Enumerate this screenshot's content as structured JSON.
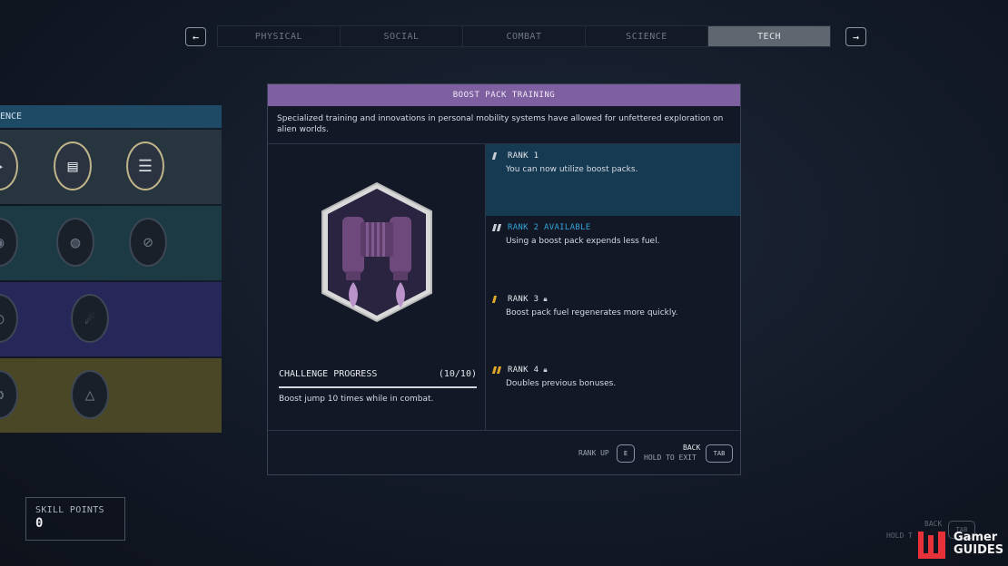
{
  "nav": {
    "prev_icon": "arrow-left-icon",
    "prev_glyph": "←",
    "next_icon": "arrow-right-icon",
    "next_glyph": "→",
    "tabs": [
      {
        "label": "PHYSICAL",
        "active": false
      },
      {
        "label": "SOCIAL",
        "active": false
      },
      {
        "label": "COMBAT",
        "active": false
      },
      {
        "label": "SCIENCE",
        "active": false
      },
      {
        "label": "TECH",
        "active": true
      }
    ]
  },
  "tree": {
    "header": "ENCE"
  },
  "modal": {
    "title": "BOOST PACK TRAINING",
    "description": "Specialized training and innovations in personal mobility systems have allowed for unfettered exploration on alien worlds.",
    "challenge": {
      "label": "CHALLENGE PROGRESS",
      "progress": "(10/10)",
      "description": "Boost jump 10 times while in combat."
    },
    "ranks": [
      {
        "label": "RANK 1",
        "text": "You can now utilize boost packs.",
        "state": "current"
      },
      {
        "label": "RANK 2 AVAILABLE",
        "text": "Using a boost pack expends less fuel.",
        "state": "available"
      },
      {
        "label": "RANK 3",
        "text": "Boost pack fuel regenerates more quickly.",
        "state": "locked"
      },
      {
        "label": "RANK 4",
        "text": "Doubles previous bonuses.",
        "state": "locked"
      }
    ],
    "footer": {
      "rank_up_label": "RANK UP",
      "rank_up_key": "E",
      "back_label": "BACK",
      "hold_exit_label": "HOLD TO EXIT",
      "exit_key": "TAB"
    }
  },
  "skill_points": {
    "label": "SKILL POINTS",
    "value": "0"
  },
  "ghost_hint": {
    "back": "BACK",
    "hold": "HOLD T",
    "key": "TAB"
  },
  "watermark": {
    "line1": "Gamer",
    "line2": "GUIDES"
  },
  "colors": {
    "accent_purple": "#7e5fa0",
    "rank_current_bg": "#163a52",
    "available_blue": "#36a3d8",
    "pip_gold": "#e0a628"
  }
}
